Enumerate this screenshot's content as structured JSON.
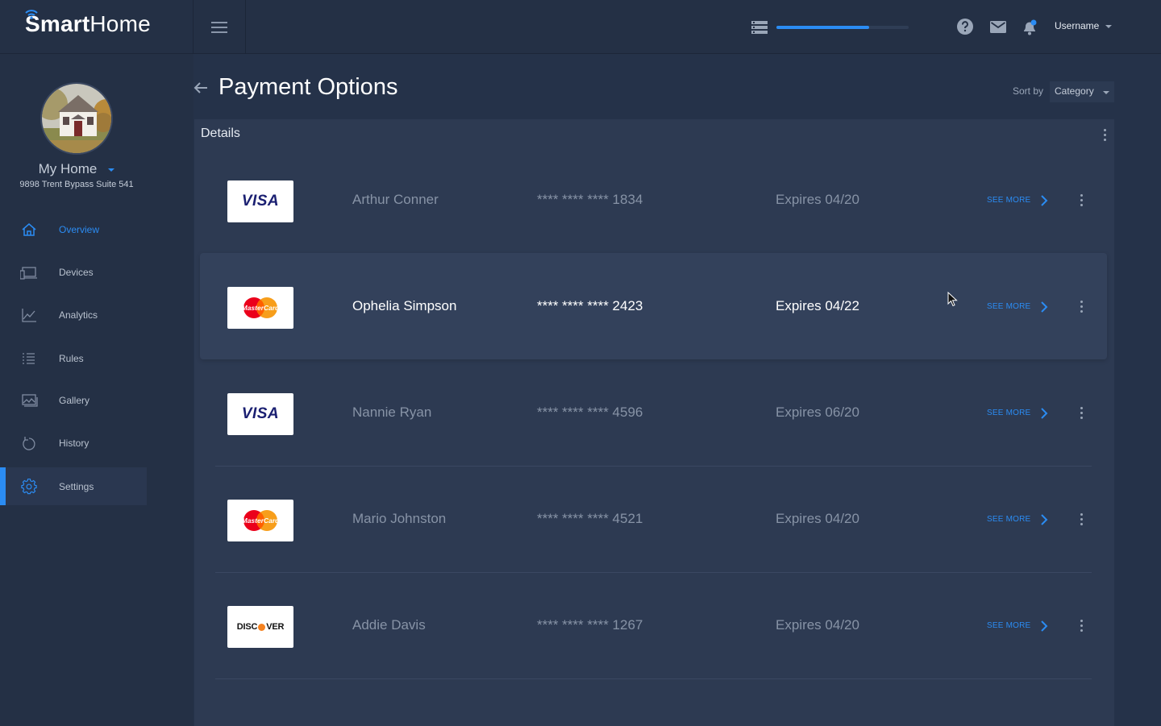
{
  "brand": {
    "name_bold": "Smart",
    "name_light": "Home"
  },
  "topbar": {
    "progress": 0.7,
    "username": "Username",
    "icons": [
      "menu-icon",
      "list-icon",
      "help-icon",
      "mail-icon",
      "bell-icon"
    ]
  },
  "sidebar": {
    "home_name": "My Home",
    "home_address": "9898 Trent Bypass Suite 541",
    "items": [
      {
        "label": "Overview",
        "icon": "home-icon"
      },
      {
        "label": "Devices",
        "icon": "devices-icon"
      },
      {
        "label": "Analytics",
        "icon": "analytics-icon"
      },
      {
        "label": "Rules",
        "icon": "rules-icon"
      },
      {
        "label": "Gallery",
        "icon": "gallery-icon"
      },
      {
        "label": "History",
        "icon": "history-icon"
      },
      {
        "label": "Settings",
        "icon": "gear-icon"
      }
    ]
  },
  "page": {
    "title": "Payment Options",
    "sort_label": "Sort by",
    "sort_value": "Category"
  },
  "card": {
    "title": "Details",
    "see_more_label": "SEE MORE",
    "rows": [
      {
        "brand": "visa",
        "brand_text": "VISA",
        "holder": "Arthur Conner",
        "number": "**** **** **** 1834",
        "expires": "Expires 04/20"
      },
      {
        "brand": "mastercard",
        "brand_text": "MasterCard",
        "holder": "Ophelia Simpson",
        "number": "**** **** **** 2423",
        "expires": "Expires 04/22"
      },
      {
        "brand": "visa",
        "brand_text": "VISA",
        "holder": "Nannie Ryan",
        "number": "**** **** **** 4596",
        "expires": "Expires 06/20"
      },
      {
        "brand": "mastercard",
        "brand_text": "MasterCard",
        "holder": "Mario Johnston",
        "number": "**** **** **** 4521",
        "expires": "Expires 04/20"
      },
      {
        "brand": "discover",
        "brand_text_a": "DISC",
        "brand_text_b": "VER",
        "holder": "Addie Davis",
        "number": "**** **** **** 1267",
        "expires": "Expires 04/20"
      }
    ]
  },
  "colors": {
    "accent": "#2b8cf3",
    "background": "#253249",
    "panel": "#2d3a52",
    "sidebar": "#243045"
  }
}
